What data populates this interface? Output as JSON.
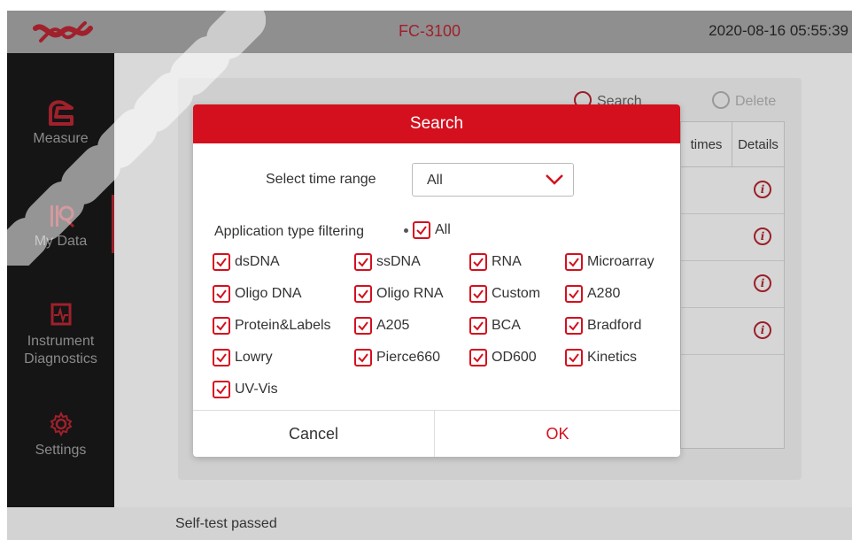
{
  "topbar": {
    "title": "FC-3100",
    "datetime": "2020-08-16 05:55:39",
    "brand_color": "#a0202c"
  },
  "sidebar": {
    "items": [
      {
        "label": "Measure",
        "icon": "measure-icon",
        "active": false
      },
      {
        "label": "My Data",
        "icon": "my-data-icon",
        "active": true
      },
      {
        "label": "Instrument Diagnostics",
        "icon": "diagnostics-icon",
        "active": false
      },
      {
        "label": "Settings",
        "icon": "gear-icon",
        "active": false
      }
    ]
  },
  "background": {
    "search_label": "Search",
    "delete_label": "Delete",
    "columns": [
      "times",
      "Details"
    ]
  },
  "status": {
    "text": "Self-test passed"
  },
  "modal": {
    "title": "Search",
    "time_range_label": "Select time range",
    "time_range_value": "All",
    "filter_label": "Application type filtering",
    "all_label": "All",
    "types": [
      "dsDNA",
      "ssDNA",
      "RNA",
      "Microarray",
      "Oligo DNA",
      "Oligo RNA",
      "Custom",
      "A280",
      "Protein&Labels",
      "A205",
      "BCA",
      "Bradford",
      "Lowry",
      "Pierce660",
      "OD600",
      "Kinetics",
      "UV-Vis"
    ],
    "cancel_label": "Cancel",
    "ok_label": "OK",
    "accent": "#d4101e"
  }
}
